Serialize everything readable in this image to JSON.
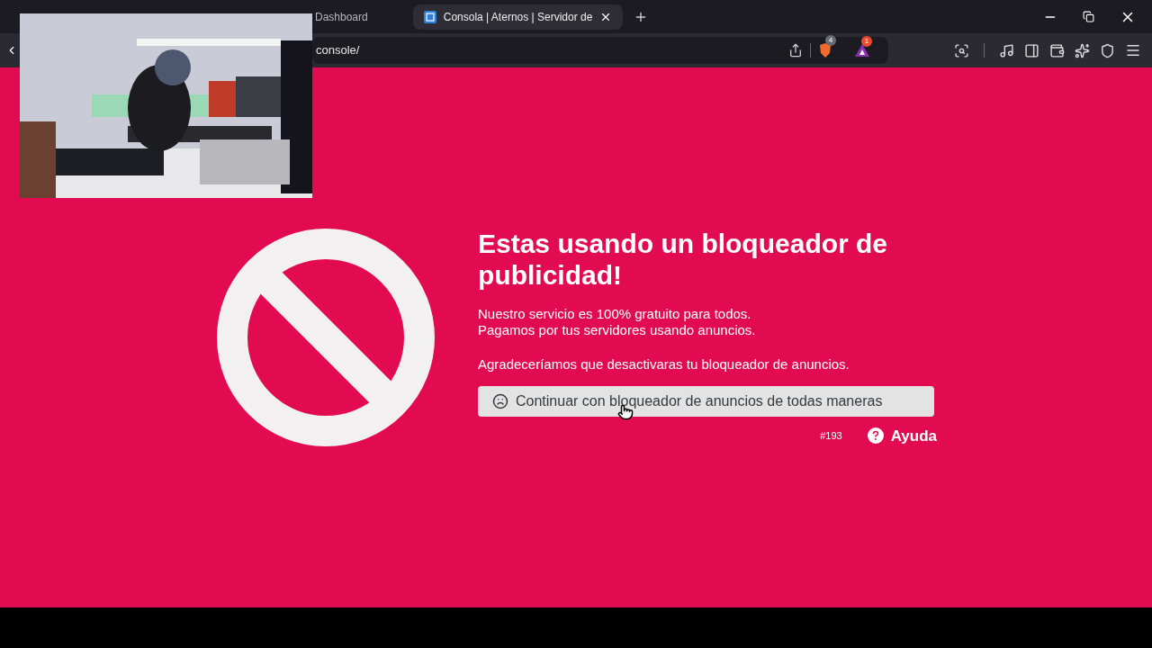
{
  "browser": {
    "tabs": [
      {
        "title": "Dashboard",
        "selected": false
      },
      {
        "title": "Consola | Aternos | Servidor de",
        "selected": true
      }
    ],
    "address": "console/",
    "shields_count": "4",
    "rewards_count": "1"
  },
  "page": {
    "title": "Estas usando un bloqueador de publicidad!",
    "lines": [
      "Nuestro servicio es 100% gratuito para todos.",
      "Pagamos por tus servidores usando anuncios."
    ],
    "request": "Agradeceríamos que desactivaras tu bloqueador de anuncios.",
    "continue_button": "Continuar con bloqueador de anuncios de todas maneras",
    "code": "#193",
    "help_link": "Ayuda"
  }
}
